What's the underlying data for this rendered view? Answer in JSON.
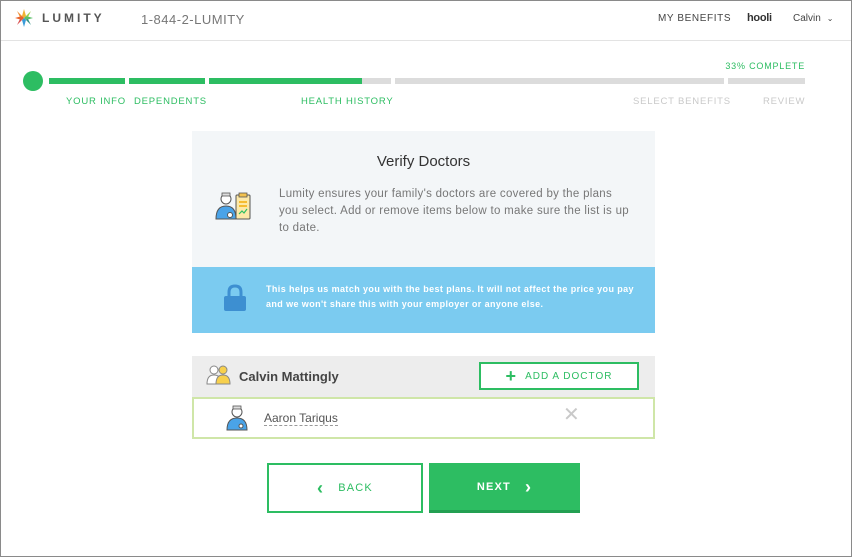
{
  "header": {
    "logo_text": "LUMITY",
    "phone": "1-844-2-LUMITY",
    "nav_my_benefits": "MY BENEFITS",
    "company": "hooli",
    "user_name": "Calvin"
  },
  "progress": {
    "percent_label": "33% COMPLETE",
    "percent_value": 0.33,
    "steps": [
      {
        "label": "YOUR INFO",
        "done": true
      },
      {
        "label": "DEPENDENTS",
        "done": true
      },
      {
        "label": "HEALTH HISTORY",
        "done": true
      },
      {
        "label": "SELECT BENEFITS",
        "done": false
      },
      {
        "label": "REVIEW",
        "done": false
      }
    ]
  },
  "card": {
    "title": "Verify Doctors",
    "description": "Lumity ensures your family's doctors are covered by the plans you select. Add or remove items below to make sure the list is up to date."
  },
  "notice": {
    "text": "This helps us match you with the best plans. It will not affect the price you pay and we won't share this with your employer or anyone else."
  },
  "member": {
    "name": "Calvin Mattingly",
    "add_doctor_label": "ADD A DOCTOR",
    "doctors": [
      {
        "name": "Aaron Tariqus"
      }
    ]
  },
  "buttons": {
    "back_label": "BACK",
    "next_label": "NEXT"
  },
  "colors": {
    "accent": "#2dbd62",
    "notice_bg": "#7bcbf0",
    "progress_off": "#dcdcdc"
  }
}
